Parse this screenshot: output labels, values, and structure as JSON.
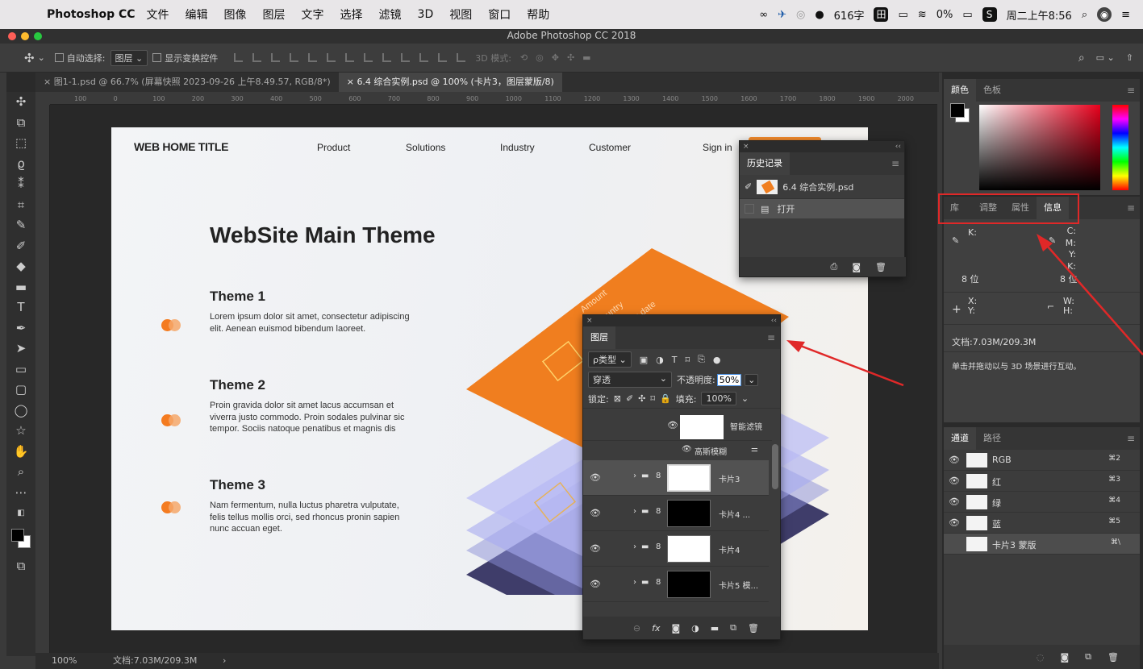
{
  "menubar": {
    "app_name": "Photoshop CC",
    "items": [
      "文件",
      "编辑",
      "图像",
      "图层",
      "文字",
      "选择",
      "滤镜",
      "3D",
      "视图",
      "窗口",
      "帮助"
    ],
    "word_count": "616字",
    "battery": "0%",
    "clock": "周二上午8:56"
  },
  "window": {
    "title": "Adobe Photoshop CC 2018"
  },
  "options": {
    "auto_select": "自动选择:",
    "auto_select_value": "图层",
    "show_transform": "显示变换控件",
    "mode3d": "3D 模式:"
  },
  "tabs": [
    {
      "label": "图1-1.psd @ 66.7% (屏幕快照 2023-09-26 上午8.49.57, RGB/8*)",
      "active": false
    },
    {
      "label": "6.4  综合实例.psd @ 100% (卡片3，图层蒙版/8)",
      "active": true
    }
  ],
  "ruler": [
    "100",
    "0",
    "100",
    "200",
    "300",
    "400",
    "500",
    "600",
    "700",
    "800",
    "900",
    "1000",
    "1100",
    "1200",
    "1300",
    "1400",
    "1500",
    "1600",
    "1700",
    "1800",
    "1900",
    "2000"
  ],
  "artboard": {
    "brand": "WEB HOME TITLE",
    "nav": [
      "Product",
      "Solutions",
      "Industry",
      "Customer",
      "Sign in"
    ],
    "headline": "WebSite Main Theme",
    "themes": [
      {
        "title": "Theme 1",
        "body": "Lorem ipsum dolor sit amet, consectetur adipiscing elit. Aenean euismod bibendum laoreet."
      },
      {
        "title": "Theme 2",
        "body": "Proin gravida dolor sit amet lacus accumsan et viverra justo commodo. Proin sodales pulvinar sic tempor. Sociis natoque penatibus et magnis dis"
      },
      {
        "title": "Theme 3",
        "body": "Nam fermentum, nulla luctus pharetra vulputate, felis tellus mollis orci, sed rhoncus pronin sapien nunc accuan eget."
      }
    ],
    "card_text": [
      "Amount",
      "Country",
      "Expiring date"
    ],
    "accent": "#f28a2c"
  },
  "history": {
    "title": "历史记录",
    "items": [
      {
        "label": "6.4  综合实例.psd"
      },
      {
        "label": "打开"
      }
    ]
  },
  "layers": {
    "title": "图层",
    "filter_kind": "ρ类型",
    "blend": "穿透",
    "opacity_label": "不透明度:",
    "opacity": "50%",
    "lock_label": "锁定:",
    "fill_label": "填充:",
    "fill": "100%",
    "smart_filter": "智能滤镜",
    "gauss": "高斯模糊",
    "rows": [
      "卡片3",
      "卡片4 ...",
      "卡片4",
      "卡片5 模..."
    ],
    "footer": [
      "fx"
    ]
  },
  "color_panel": {
    "tabs": [
      "颜色",
      "色板"
    ]
  },
  "info_panel": {
    "tabs": [
      "库",
      "调整",
      "属性",
      "信息"
    ],
    "k_label": "K:",
    "cmyk": [
      "C:",
      "M:",
      "Y:",
      "K:"
    ],
    "bit_left": "8 位",
    "bit_right": "8 位",
    "xy": [
      "X:",
      "Y:"
    ],
    "wh": [
      "W:",
      "H:"
    ],
    "doc": "文档:7.03M/209.3M",
    "hint": "单击并拖动以与 3D 场景进行互动。"
  },
  "channels": {
    "tabs": [
      "通道",
      "路径"
    ],
    "rows": [
      {
        "name": "RGB",
        "key": "⌘2"
      },
      {
        "name": "红",
        "key": "⌘3"
      },
      {
        "name": "绿",
        "key": "⌘4"
      },
      {
        "name": "蓝",
        "key": "⌘5"
      },
      {
        "name": "卡片3 蒙版",
        "key": "⌘\\"
      }
    ]
  },
  "status": {
    "zoom": "100%",
    "doc": "文档:7.03M/209.3M"
  }
}
